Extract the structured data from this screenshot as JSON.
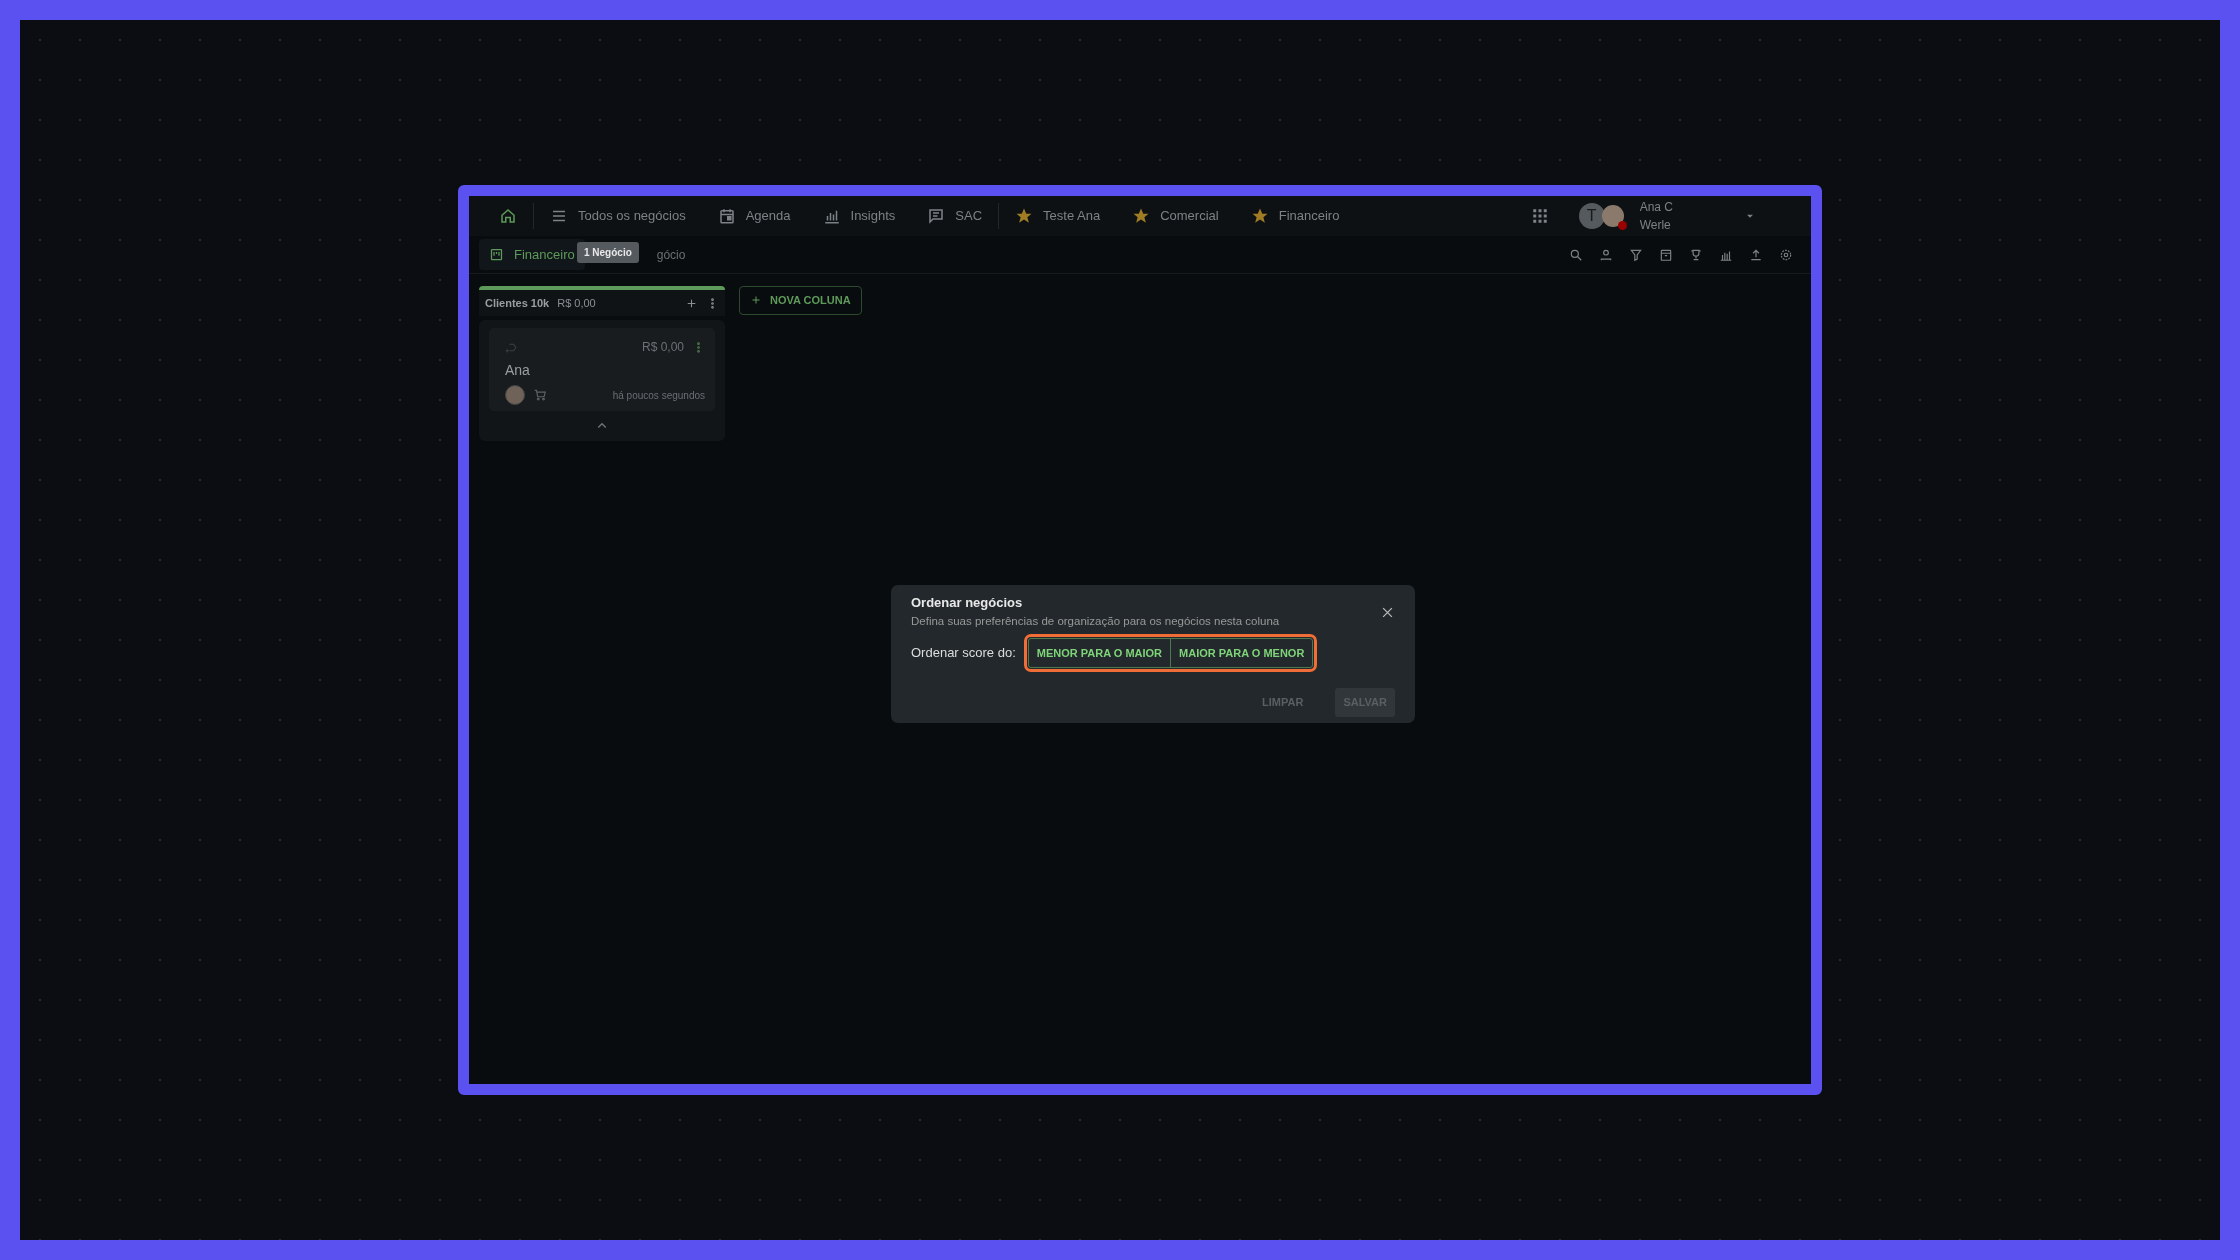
{
  "nav": {
    "items": [
      {
        "kind": "list",
        "label": "Todos os negócios"
      },
      {
        "kind": "calendar",
        "label": "Agenda"
      },
      {
        "kind": "chart",
        "label": "Insights"
      },
      {
        "kind": "chat",
        "label": "SAC"
      }
    ],
    "favorites": [
      {
        "label": "Teste Ana"
      },
      {
        "label": "Comercial"
      },
      {
        "label": "Financeiro"
      }
    ],
    "user": {
      "initial": "T",
      "name_lines": [
        "Ana C",
        "Werle"
      ]
    }
  },
  "subbar": {
    "board": {
      "label": "Financeiro",
      "selected": true
    },
    "count_visible": "gócio",
    "tooltip": "1 Negócio"
  },
  "columns": [
    {
      "title": "Clientes 10k",
      "total": "R$ 0,00",
      "cards": [
        {
          "value": "R$ 0,00",
          "name": "Ana",
          "time": "há poucos segundos"
        }
      ]
    }
  ],
  "new_column_button": "NOVA COLUNA",
  "dialog": {
    "title": "Ordenar negócios",
    "subtitle": "Defina suas preferências de organização para os negócios nesta coluna",
    "label": "Ordenar score do:",
    "options": [
      {
        "label": "MENOR PARA O MAIOR",
        "selected": false
      },
      {
        "label": "MAIOR PARA O MENOR",
        "selected": false
      }
    ],
    "clear_button": {
      "label": "LIMPAR",
      "disabled": true
    },
    "save_button": {
      "label": "SALVAR",
      "disabled": true
    }
  }
}
